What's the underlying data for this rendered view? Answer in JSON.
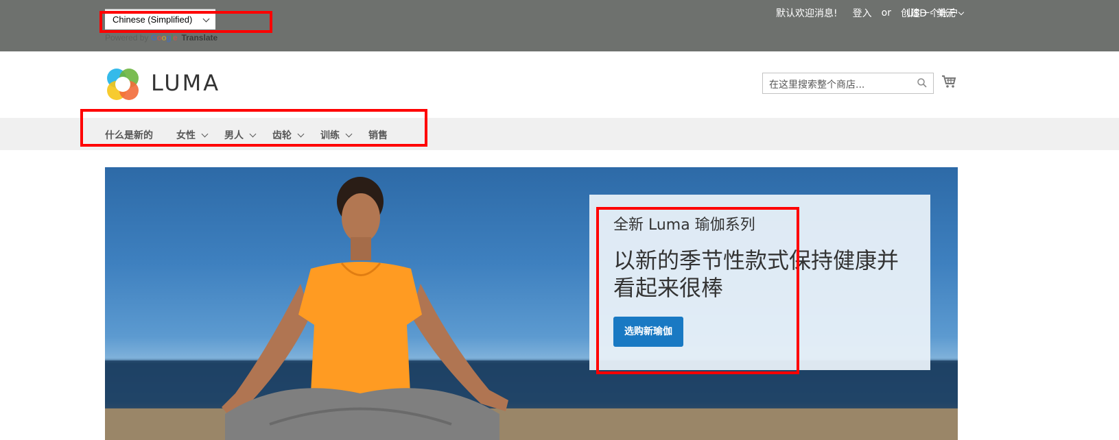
{
  "translate": {
    "language": "Chinese (Simplified)",
    "powered_by": "Powered by",
    "google": "Google",
    "translate_label": "Translate"
  },
  "header": {
    "welcome": "默认欢迎消息!",
    "sign_in": "登入",
    "or": "or",
    "create_account": "创建一个帐户",
    "currency": "USD - 美元"
  },
  "logo": {
    "text": "LUMA"
  },
  "search": {
    "placeholder": "在这里搜索整个商店..."
  },
  "nav": {
    "items": [
      {
        "label": "什么是新的",
        "has_dropdown": false
      },
      {
        "label": "女性",
        "has_dropdown": true
      },
      {
        "label": "男人",
        "has_dropdown": true
      },
      {
        "label": "齿轮",
        "has_dropdown": true
      },
      {
        "label": "训练",
        "has_dropdown": true
      },
      {
        "label": "销售",
        "has_dropdown": false
      }
    ]
  },
  "hero": {
    "subtitle": "全新 Luma 瑜伽系列",
    "title": "以新的季节性款式保持健康并看起来很棒",
    "button": "选购新瑜伽"
  },
  "colors": {
    "topbar": "#6e716e",
    "nav_bg": "#f0f0f0",
    "button": "#1979c3",
    "annotation": "#ff0000"
  }
}
